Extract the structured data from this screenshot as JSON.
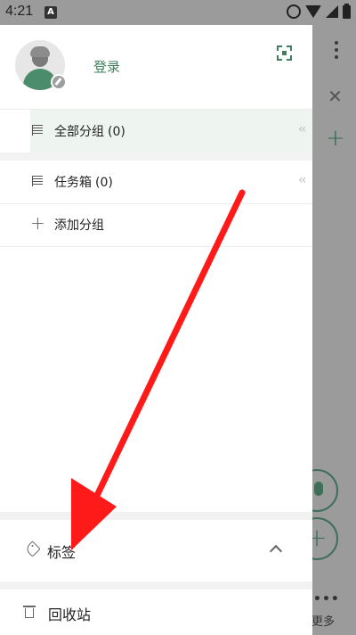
{
  "status_bar": {
    "time": "4:21",
    "notification_badge": "A"
  },
  "drawer": {
    "profile": {
      "login_label": "登录"
    },
    "groups": [
      {
        "label": "全部分组",
        "count": "(0)",
        "selected": true
      },
      {
        "label": "任务箱",
        "count": "(0)",
        "selected": false
      }
    ],
    "add_group_label": "添加分组",
    "tags_section_label": "标签",
    "trash_label": "回收站"
  },
  "background_app": {
    "more_label": "更多"
  },
  "colors": {
    "accent": "#3f7f62",
    "selected_row_bg": "#eef5f1",
    "annotation_arrow": "#ff1a1a"
  },
  "icons": {
    "scan": "qr-scan-icon",
    "group": "list-icon",
    "add": "plus-icon",
    "tag": "tag-icon",
    "trash": "trash-icon"
  }
}
